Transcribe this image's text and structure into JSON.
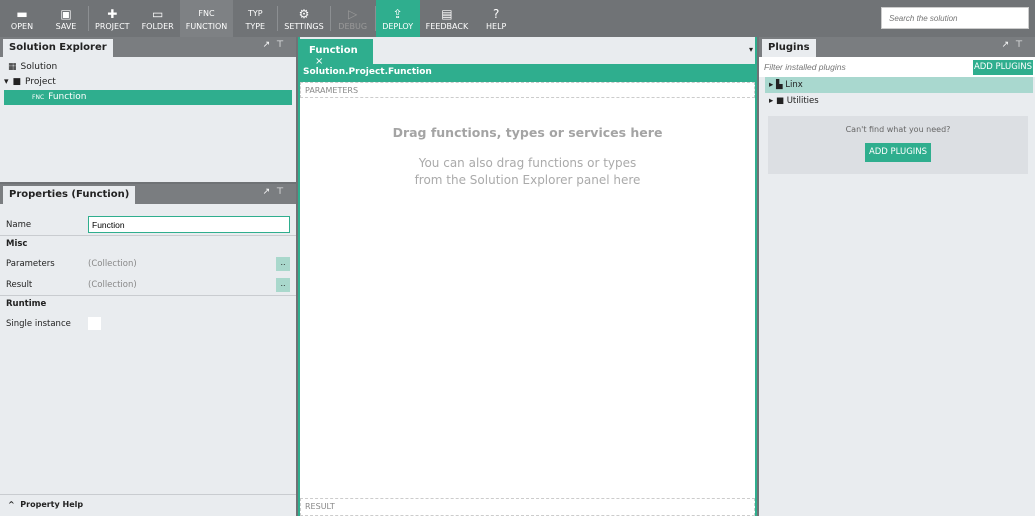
{
  "toolbar": {
    "items": [
      {
        "label": "OPEN",
        "icon": "folder-open-icon",
        "glyph": "▬"
      },
      {
        "label": "SAVE",
        "icon": "save-icon",
        "glyph": "▣"
      },
      {
        "label": "PROJECT",
        "icon": "new-project-icon",
        "glyph": "✚"
      },
      {
        "label": "FOLDER",
        "icon": "folder-icon",
        "glyph": "▭"
      },
      {
        "label": "FUNCTION",
        "icon": "function-icon",
        "glyph": "FNC"
      },
      {
        "label": "TYPE",
        "icon": "type-icon",
        "glyph": "TYP"
      },
      {
        "label": "SETTINGS",
        "icon": "gear-icon",
        "glyph": "⚙"
      },
      {
        "label": "DEBUG",
        "icon": "play-icon",
        "glyph": "▷"
      },
      {
        "label": "DEPLOY",
        "icon": "upload-icon",
        "glyph": "⇪"
      },
      {
        "label": "FEEDBACK",
        "icon": "comment-icon",
        "glyph": "▤"
      },
      {
        "label": "HELP",
        "icon": "help-icon",
        "glyph": "?"
      }
    ],
    "search_placeholder": "Search the solution"
  },
  "explorer": {
    "title": "Solution Explorer",
    "solution": "Solution",
    "project": "Project",
    "fn_tag": "FNC",
    "function": "Function"
  },
  "properties": {
    "title": "Properties (Function)",
    "name_label": "Name",
    "name_value": "Function",
    "misc": "Misc",
    "parameters_label": "Parameters",
    "parameters_value": "(Collection)",
    "result_label": "Result",
    "result_value": "(Collection)",
    "dots": "..",
    "runtime": "Runtime",
    "single_instance_label": "Single instance",
    "help": "Property Help"
  },
  "editor": {
    "tab": "Function",
    "close": "×",
    "path": "Solution.Project.Function",
    "parameters": "PARAMETERS",
    "drag_title": "Drag functions, types or services here",
    "drag_sub1": "You can also drag functions or types",
    "drag_sub2": "from the Solution Explorer panel here",
    "result": "RESULT"
  },
  "plugins": {
    "title": "Plugins",
    "filter_placeholder": "Filter installed plugins",
    "add_button": "ADD PLUGINS",
    "items": [
      "Linx",
      "Utilities"
    ],
    "cant_find": "Can't find what you need?",
    "add_button2": "ADD PLUGINS"
  },
  "colors": {
    "accent": "#2fae8e",
    "toolbar": "#707376"
  }
}
